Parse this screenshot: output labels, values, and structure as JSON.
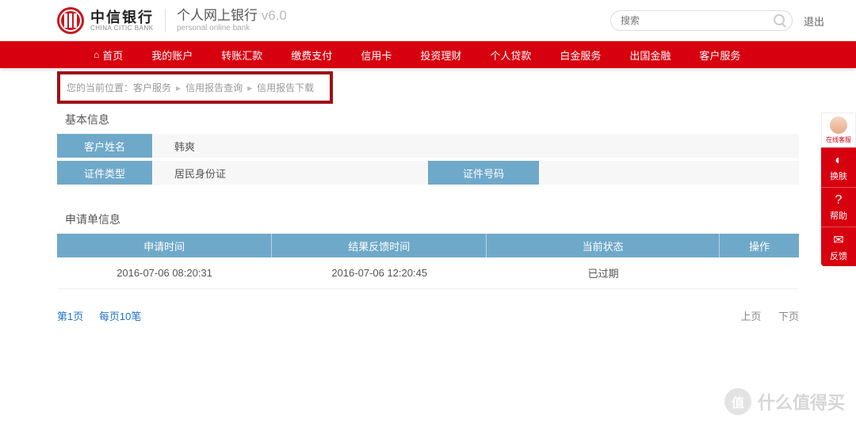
{
  "brand": {
    "cn": "中信银行",
    "en": "CHINA CITIC BANK"
  },
  "product": {
    "cn_prefix": "个人网上银行 ",
    "version": "v6.0",
    "en": "personal online bank"
  },
  "search": {
    "placeholder": "搜索"
  },
  "logout": "退出",
  "nav": {
    "items": [
      {
        "label": "首页",
        "home": true
      },
      {
        "label": "我的账户"
      },
      {
        "label": "转账汇款"
      },
      {
        "label": "缴费支付"
      },
      {
        "label": "信用卡"
      },
      {
        "label": "投资理财"
      },
      {
        "label": "个人贷款"
      },
      {
        "label": "白金服务"
      },
      {
        "label": "出国金融"
      },
      {
        "label": "客户服务",
        "active": true
      }
    ]
  },
  "breadcrumb": {
    "prefix": "您的当前位置：",
    "items": [
      "客户服务",
      "信用报告查询",
      "信用报告下载"
    ]
  },
  "sections": {
    "basic_title": "基本信息",
    "name_label": "客户姓名",
    "name_value": "韩爽",
    "idtype_label": "证件类型",
    "idtype_value": "居民身份证",
    "idno_label": "证件号码",
    "idno_value": "",
    "apply_title": "申请单信息"
  },
  "table": {
    "headers": [
      "申请时间",
      "结果反馈时间",
      "当前状态",
      "操作"
    ],
    "rows": [
      {
        "apply": "2016-07-06 08:20:31",
        "feedback": "2016-07-06 12:20:45",
        "status": "已过期",
        "op": ""
      }
    ]
  },
  "pager": {
    "page": "第1页",
    "size": "每页10笔",
    "prev": "上页",
    "next": "下页"
  },
  "side": {
    "avatar_label": "在线客服",
    "items": [
      {
        "icon": "◐",
        "label": "换肤"
      },
      {
        "icon": "?",
        "label": "帮助"
      },
      {
        "icon": "✉",
        "label": "反馈"
      }
    ]
  },
  "watermark": {
    "icon": "值",
    "text": "什么值得买"
  }
}
